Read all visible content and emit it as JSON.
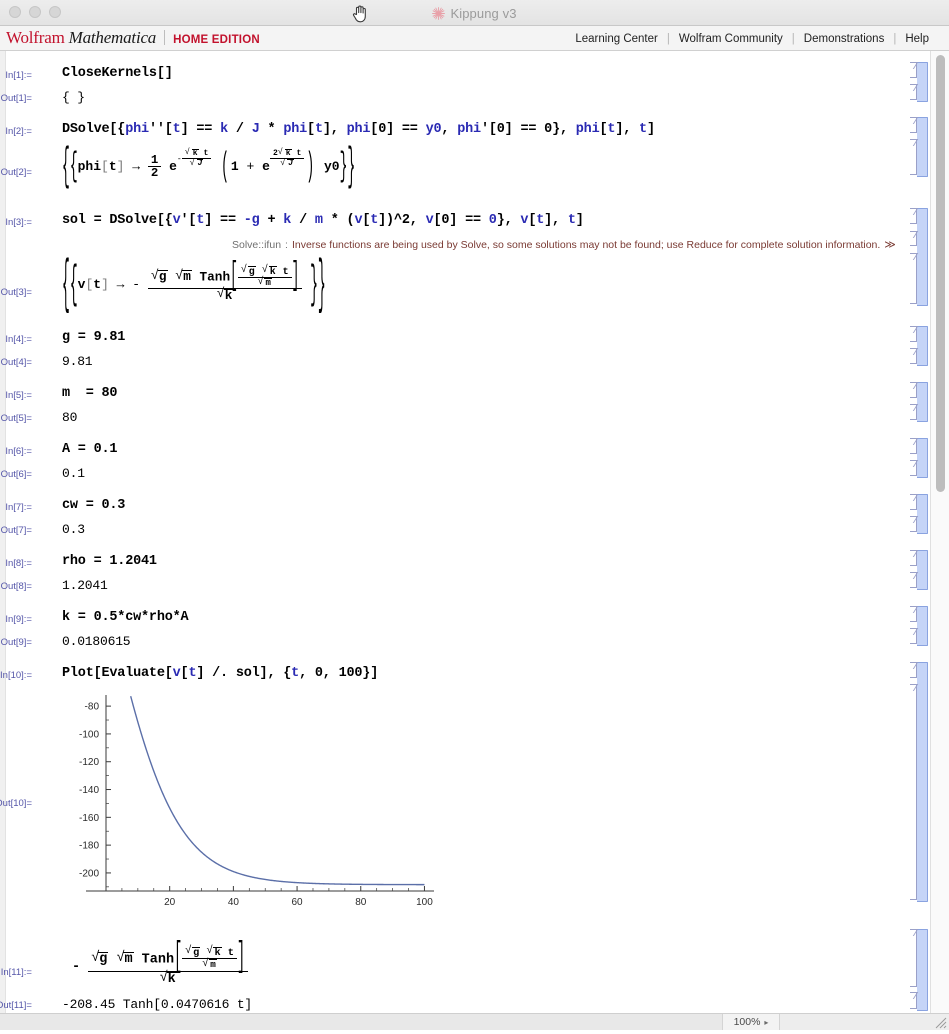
{
  "window": {
    "title": "Kippung v3",
    "icon": "mathematica-spikey-icon",
    "traffic_lights": [
      "close",
      "minimize",
      "zoom"
    ]
  },
  "header": {
    "brand_primary": "Wolfram",
    "brand_secondary": "Mathematica",
    "edition": "HOME EDITION",
    "links": [
      {
        "label": "Learning Center"
      },
      {
        "label": "Wolfram Community"
      },
      {
        "label": "Demonstrations"
      },
      {
        "label": "Help"
      }
    ],
    "separator": "|"
  },
  "notebook": {
    "cells": [
      {
        "in_label": "In[1]:=",
        "input": "CloseKernels[]",
        "out_label": "Out[1]=",
        "output": "{}"
      },
      {
        "in_label": "In[2]:=",
        "input": "DSolve[{phi''[t] == k/J*phi[t], phi[0] == y0, phi'[0] == 0}, phi[t], t]",
        "out_label": "Out[2]=",
        "output": "{{phi[t] -> 1/2 E^(-(Sqrt[k] t)/Sqrt[J]) (1 + E^((2 Sqrt[k] t)/Sqrt[J])) y0}}"
      },
      {
        "in_label": "In[3]:=",
        "input": "sol = DSolve[{v'[t] == -g + k/m*(v[t])^2, v[0] == 0}, v[t], t]",
        "message_name": "Solve::ifun",
        "message_sep": ":",
        "message_text": "Inverse functions are being used by Solve, so some solutions may not be found; use Reduce for complete solution information.",
        "message_more": "≫",
        "out_label": "Out[3]=",
        "output": "{{v[t] -> -(Sqrt[g] Sqrt[m] Tanh[(Sqrt[g] Sqrt[k] t)/Sqrt[m]])/Sqrt[k]}}"
      },
      {
        "in_label": "In[4]:=",
        "input": "g = 9.81",
        "out_label": "Out[4]=",
        "output": "9.81"
      },
      {
        "in_label": "In[5]:=",
        "input": "m  = 80",
        "out_label": "Out[5]=",
        "output": "80"
      },
      {
        "in_label": "In[6]:=",
        "input": "A = 0.1",
        "out_label": "Out[6]=",
        "output": "0.1"
      },
      {
        "in_label": "In[7]:=",
        "input": "cw = 0.3",
        "out_label": "Out[7]=",
        "output": "0.3"
      },
      {
        "in_label": "In[8]:=",
        "input": "rho = 1.2041",
        "out_label": "Out[8]=",
        "output": "1.2041"
      },
      {
        "in_label": "In[9]:=",
        "input": "k = 0.5*cw*rho*A",
        "out_label": "Out[9]=",
        "output": "0.0180615"
      },
      {
        "in_label": "In[10]:=",
        "input": "Plot[Evaluate[v[t] /. sol], {t, 0, 100}]",
        "out_label": "Out[10]=",
        "output": "plot-graphic"
      },
      {
        "in_label": "In[11]:=",
        "input": "-(Sqrt[g] Sqrt[m] Tanh[(Sqrt[g] Sqrt[k] t)/Sqrt[m]])/Sqrt[k]",
        "out_label": "Out[11]=",
        "output": "-208.45 Tanh[0.0470616 t]"
      }
    ],
    "tokens": {
      "in1": [
        "CloseKernels",
        "[",
        "]"
      ],
      "out1": "{ }",
      "in2_parts": [
        "DSolve[{",
        "phi",
        "''[",
        "t",
        "] == ",
        "k",
        " / ",
        "J",
        " * ",
        "phi",
        "[",
        "t",
        "], ",
        "phi",
        "[0] == ",
        "y0",
        ", ",
        "phi",
        "'[0] == 0}, ",
        "phi",
        "[",
        "t",
        "], ",
        "t",
        "]"
      ],
      "in3_parts": [
        "sol = ",
        "DSolve[{",
        "v",
        "'[",
        "t",
        "] == ",
        "-g",
        " + ",
        "k",
        " / ",
        "m",
        " * (",
        "v",
        "[",
        "t",
        "])",
        "^2, ",
        "v",
        "[0] == ",
        "0",
        "}, ",
        "v",
        "[",
        "t",
        "], ",
        "t",
        "]"
      ],
      "in10_parts": [
        "Plot[Evaluate[",
        "v",
        "[",
        "t",
        "] /. sol], {",
        "t",
        ", 0, 100}]"
      ]
    }
  },
  "chart_data": {
    "type": "line",
    "title": "",
    "xlabel": "",
    "ylabel": "",
    "xlim": [
      0,
      103
    ],
    "ylim": [
      -213,
      -72
    ],
    "xticks": [
      20,
      40,
      60,
      80,
      100
    ],
    "yticks": [
      -80,
      -100,
      -120,
      -140,
      -160,
      -180,
      -200
    ],
    "xtick_labels": [
      "20",
      "40",
      "60",
      "80",
      "100"
    ],
    "ytick_labels": [
      "-80",
      "-100",
      "-120",
      "-140",
      "-160",
      "-180",
      "-200"
    ],
    "grid": false,
    "legend": false,
    "line_color": "#5b6fa8",
    "formula": "-208.45 Tanh[0.0470616 t]",
    "amplitude": -208.45,
    "rate": 0.0470616,
    "series": [
      {
        "name": "v[t]",
        "x": [
          7.5,
          10,
          12.5,
          15,
          17.5,
          20,
          22.5,
          25,
          27.5,
          30,
          32.5,
          35,
          37.5,
          40,
          42.5,
          45,
          47.5,
          50,
          55,
          60,
          65,
          70,
          75,
          80,
          85,
          90,
          95,
          100
        ],
        "y": [
          -72.8,
          -95.0,
          -115.1,
          -132.8,
          -148.2,
          -161.2,
          -172.1,
          -181.2,
          -188.6,
          -194.7,
          -199.6,
          -203.5,
          -206.7,
          -209.2,
          -211.2,
          -212.8,
          -214.0,
          -215.0,
          -216.4,
          -217.2,
          -217.8,
          -218.1,
          -218.3,
          -218.4,
          -218.45,
          -218.46,
          -218.47,
          -218.47
        ]
      }
    ]
  },
  "statusbar": {
    "zoom": "100%",
    "zoom_arrow": "▸"
  }
}
